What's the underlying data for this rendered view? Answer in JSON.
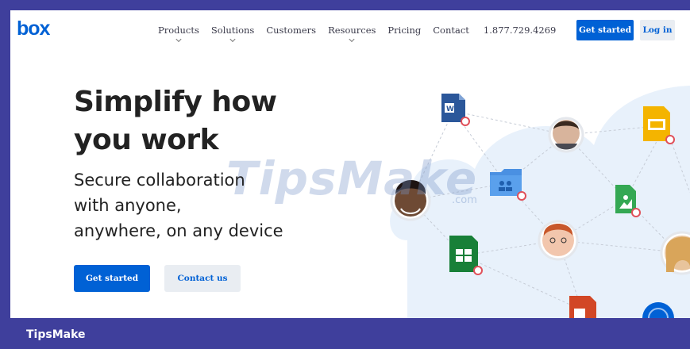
{
  "nav": {
    "logo": "box",
    "links": [
      "Products",
      "Solutions",
      "Customers",
      "Resources",
      "Pricing",
      "Contact"
    ],
    "phone": "1.877.729.4269",
    "get_started": "Get started",
    "login": "Log in"
  },
  "hero": {
    "title_line1": "Simplify how",
    "title_line2": "you work",
    "sub_line1": "Secure collaboration",
    "sub_line2": "with anyone,",
    "sub_line3": "anywhere, on any device",
    "get_started": "Get started",
    "contact": "Contact us"
  },
  "watermark": {
    "text": "TipsMake",
    "suffix": ".com"
  },
  "footer": {
    "brand": "TipsMake"
  },
  "colors": {
    "primary": "#0061d5",
    "footer": "#3f3f9c",
    "secondary_btn": "#e9edf2"
  },
  "icons": [
    "word-doc-icon",
    "slides-doc-icon",
    "people-folder-icon",
    "image-file-icon",
    "spreadsheet-icon",
    "powerpoint-icon"
  ]
}
